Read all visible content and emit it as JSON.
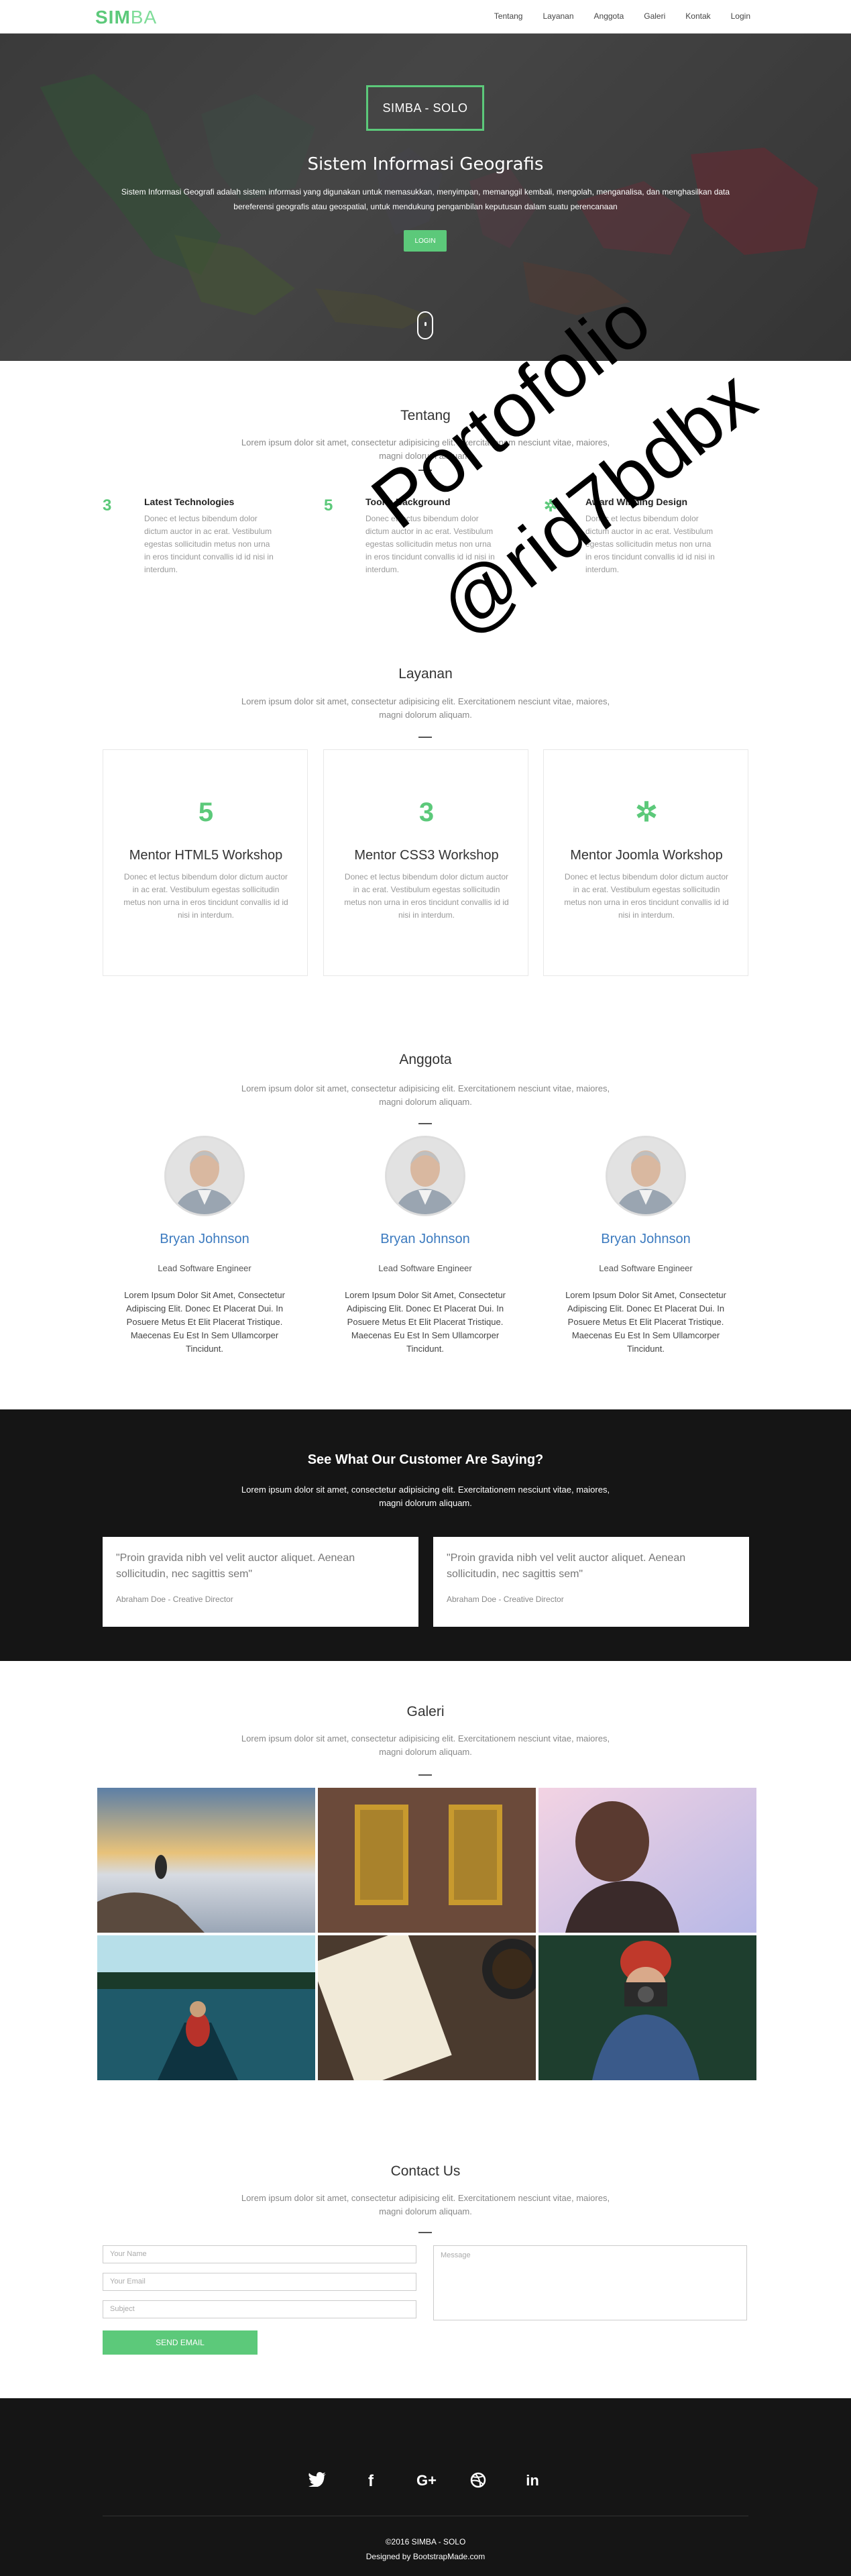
{
  "nav": {
    "brand_a": "SIM",
    "brand_b": "BA",
    "items": [
      "Tentang",
      "Layanan",
      "Anggota",
      "Galeri",
      "Kontak",
      "Login"
    ]
  },
  "hero": {
    "badge": "SIMBA - SOLO",
    "title": "Sistem Informasi Geografis",
    "desc": "Sistem Informasi Geografi adalah sistem informasi yang digunakan untuk memasukkan, menyimpan, memanggil kembali, mengolah, menganalisa, dan menghasilkan data bereferensi geografis atau geospatial, untuk mendukung pengambilan keputusan dalam suatu perencanaan",
    "button": "LOGIN"
  },
  "about": {
    "title": "Tentang",
    "sub": "Lorem ipsum dolor sit amet, consectetur adipisicing elit. Exercitationem nesciunt vitae, maiores, magni dolorum aliquam.",
    "features": [
      {
        "title": "Latest Technologies",
        "text": "Donec et lectus bibendum dolor dictum auctor in ac erat. Vestibulum egestas sollicitudin metus non urna in eros tincidunt convallis id id nisi in interdum."
      },
      {
        "title": "Toons Background",
        "text": "Donec et lectus bibendum dolor dictum auctor in ac erat. Vestibulum egestas sollicitudin metus non urna in eros tincidunt convallis id id nisi in interdum."
      },
      {
        "title": "Award Winning Design",
        "text": "Donec et lectus bibendum dolor dictum auctor in ac erat. Vestibulum egestas sollicitudin metus non urna in eros tincidunt convallis id id nisi in interdum."
      }
    ]
  },
  "services": {
    "title": "Layanan",
    "sub": "Lorem ipsum dolor sit amet, consectetur adipisicing elit. Exercitationem nesciunt vitae, maiores, magni dolorum aliquam.",
    "cards": [
      {
        "title": "Mentor HTML5 Workshop",
        "text": "Donec et lectus bibendum dolor dictum auctor in ac erat. Vestibulum egestas sollicitudin metus non urna in eros tincidunt convallis id id nisi in interdum."
      },
      {
        "title": "Mentor CSS3 Workshop",
        "text": "Donec et lectus bibendum dolor dictum auctor in ac erat. Vestibulum egestas sollicitudin metus non urna in eros tincidunt convallis id id nisi in interdum."
      },
      {
        "title": "Mentor Joomla Workshop",
        "text": "Donec et lectus bibendum dolor dictum auctor in ac erat. Vestibulum egestas sollicitudin metus non urna in eros tincidunt convallis id id nisi in interdum."
      }
    ]
  },
  "team": {
    "title": "Anggota",
    "sub": "Lorem ipsum dolor sit amet, consectetur adipisicing elit. Exercitationem nesciunt vitae, maiores, magni dolorum aliquam.",
    "members": [
      {
        "name": "Bryan Johnson",
        "role": "Lead Software Engineer",
        "desc": "Lorem Ipsum Dolor Sit Amet, Consectetur Adipiscing Elit. Donec Et Placerat Dui. In Posuere Metus Et Elit Placerat Tristique. Maecenas Eu Est In Sem Ullamcorper Tincidunt."
      },
      {
        "name": "Bryan Johnson",
        "role": "Lead Software Engineer",
        "desc": "Lorem Ipsum Dolor Sit Amet, Consectetur Adipiscing Elit. Donec Et Placerat Dui. In Posuere Metus Et Elit Placerat Tristique. Maecenas Eu Est In Sem Ullamcorper Tincidunt."
      },
      {
        "name": "Bryan Johnson",
        "role": "Lead Software Engineer",
        "desc": "Lorem Ipsum Dolor Sit Amet, Consectetur Adipiscing Elit. Donec Et Placerat Dui. In Posuere Metus Et Elit Placerat Tristique. Maecenas Eu Est In Sem Ullamcorper Tincidunt."
      }
    ]
  },
  "testimonials": {
    "title": "See What Our Customer Are Saying?",
    "sub": "Lorem ipsum dolor sit amet, consectetur adipisicing elit. Exercitationem nesciunt vitae, maiores, magni dolorum aliquam.",
    "items": [
      {
        "quote": "\"Proin gravida nibh vel velit auctor aliquet. Aenean sollicitudin, nec sagittis sem\"",
        "author": "Abraham Doe - Creative Director"
      },
      {
        "quote": "\"Proin gravida nibh vel velit auctor aliquet. Aenean sollicitudin, nec sagittis sem\"",
        "author": "Abraham Doe - Creative Director"
      }
    ]
  },
  "gallery": {
    "title": "Galeri",
    "sub": "Lorem ipsum dolor sit amet, consectetur adipisicing elit. Exercitationem nesciunt vitae, maiores, magni dolorum aliquam."
  },
  "contact": {
    "title": "Contact Us",
    "sub": "Lorem ipsum dolor sit amet, consectetur adipisicing elit. Exercitationem nesciunt vitae, maiores, magni dolorum aliquam.",
    "name_placeholder": "Your Name",
    "email_placeholder": "Your Email",
    "subject_placeholder": "Subject",
    "message_placeholder": "Message",
    "send": "SEND EMAIL"
  },
  "footer": {
    "copyright": "©2016 SIMBA - SOLO",
    "designed_prefix": "Designed by",
    "designed_by": "BootstrapMade.com"
  },
  "watermark": {
    "line1": "Portofolio",
    "line2": "@rid7bdbx"
  },
  "colors": {
    "accent": "#5cc97a",
    "name_link": "#3b7abf",
    "dark": "#151515"
  },
  "icons": [
    "css3-icon",
    "html5-icon",
    "joomla-icon",
    "twitter-icon",
    "facebook-icon",
    "google-plus-icon",
    "dribbble-icon",
    "linkedin-icon",
    "scroll-mouse-icon"
  ]
}
